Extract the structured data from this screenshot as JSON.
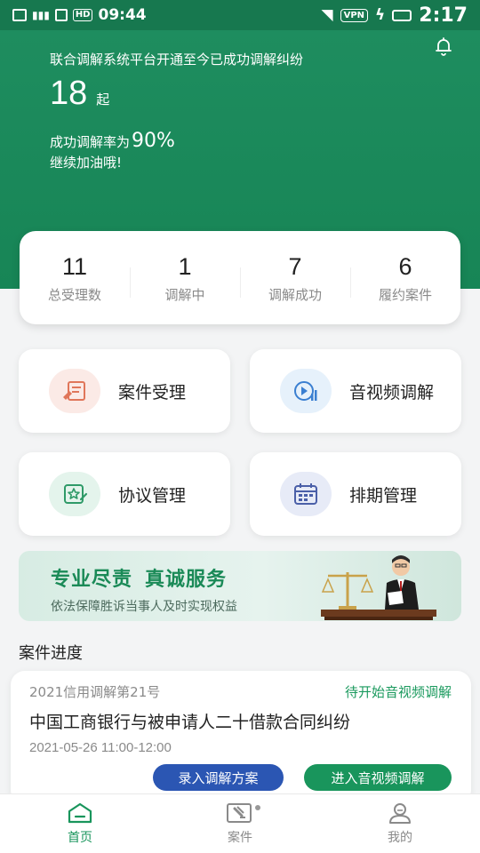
{
  "status_bar": {
    "time_left": "09:44",
    "hd_badge": "HD",
    "vpn_badge": "VPN",
    "time_right": "2:17"
  },
  "hero": {
    "intro": "联合调解系统平台开通至今已成功调解纠纷",
    "count": "18",
    "count_unit": "起",
    "rate_prefix": "成功调解率为",
    "rate_value": "90%",
    "cheer": "继续加油哦!"
  },
  "stats": [
    {
      "value": "11",
      "label": "总受理数"
    },
    {
      "value": "1",
      "label": "调解中"
    },
    {
      "value": "7",
      "label": "调解成功"
    },
    {
      "value": "6",
      "label": "履约案件"
    }
  ],
  "tiles": [
    {
      "label": "案件受理",
      "icon": "case-acceptance-icon",
      "color": "#e0765a"
    },
    {
      "label": "音视频调解",
      "icon": "video-mediation-icon",
      "color": "#3a7fd1"
    },
    {
      "label": "协议管理",
      "icon": "agreement-icon",
      "color": "#2f9a68"
    },
    {
      "label": "排期管理",
      "icon": "calendar-icon",
      "color": "#4a5fa8"
    }
  ],
  "banner": {
    "title_part1": "专业尽责",
    "title_part2": "真诚服务",
    "subtitle": "依法保障胜诉当事人及时实现权益"
  },
  "case_section": {
    "title": "案件进度",
    "card": {
      "number": "2021信用调解第21号",
      "status": "待开始音视频调解",
      "title": "中国工商银行与被申请人二十借款合同纠纷",
      "time": "2021-05-26 11:00-12:00",
      "btn_plan": "录入调解方案",
      "btn_video": "进入音视频调解"
    }
  },
  "tabbar": [
    {
      "label": "首页",
      "icon": "home-icon",
      "active": true
    },
    {
      "label": "案件",
      "icon": "gavel-icon",
      "active": false
    },
    {
      "label": "我的",
      "icon": "profile-icon",
      "active": false
    }
  ],
  "colors": {
    "brand_green": "#1b8a5c",
    "accent_blue": "#2b56b3",
    "accent_green": "#19955c"
  }
}
